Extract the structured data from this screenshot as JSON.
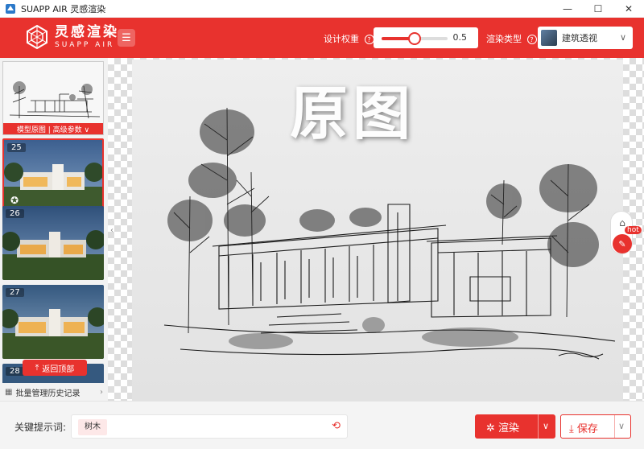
{
  "window": {
    "title": "SUAPP AIR 灵感渲染",
    "controls": {
      "minimize": "—",
      "maximize": "☐",
      "close": "✕"
    }
  },
  "header": {
    "logo_cn": "灵感渲染",
    "logo_en": "SUAPP AIR",
    "menu_icon": "hamburger-icon",
    "design_weight": {
      "label": "设计权重",
      "value": "0.5",
      "level": 0.5
    },
    "render_type": {
      "label": "渲染类型",
      "selected": "建筑透视"
    }
  },
  "sidebar": {
    "original": {
      "bar_label": "模型原图 | 高级参数 ∨"
    },
    "history": [
      {
        "num": "25",
        "selected": true
      },
      {
        "num": "26",
        "selected": false
      },
      {
        "num": "27",
        "selected": false
      },
      {
        "num": "28",
        "selected": false
      }
    ],
    "back_to_top": "返回顶部",
    "batch_manage": "批量管理历史记录"
  },
  "canvas": {
    "overlay_label": "原图"
  },
  "float_tools": {
    "hot_badge": "hot"
  },
  "bottom": {
    "prompt_label": "关键提示词:",
    "prompt_tag": "树木",
    "render_button": "渲染",
    "save_button": "保存"
  },
  "colors": {
    "accent": "#e8322e",
    "header_bg": "#e8322e"
  }
}
